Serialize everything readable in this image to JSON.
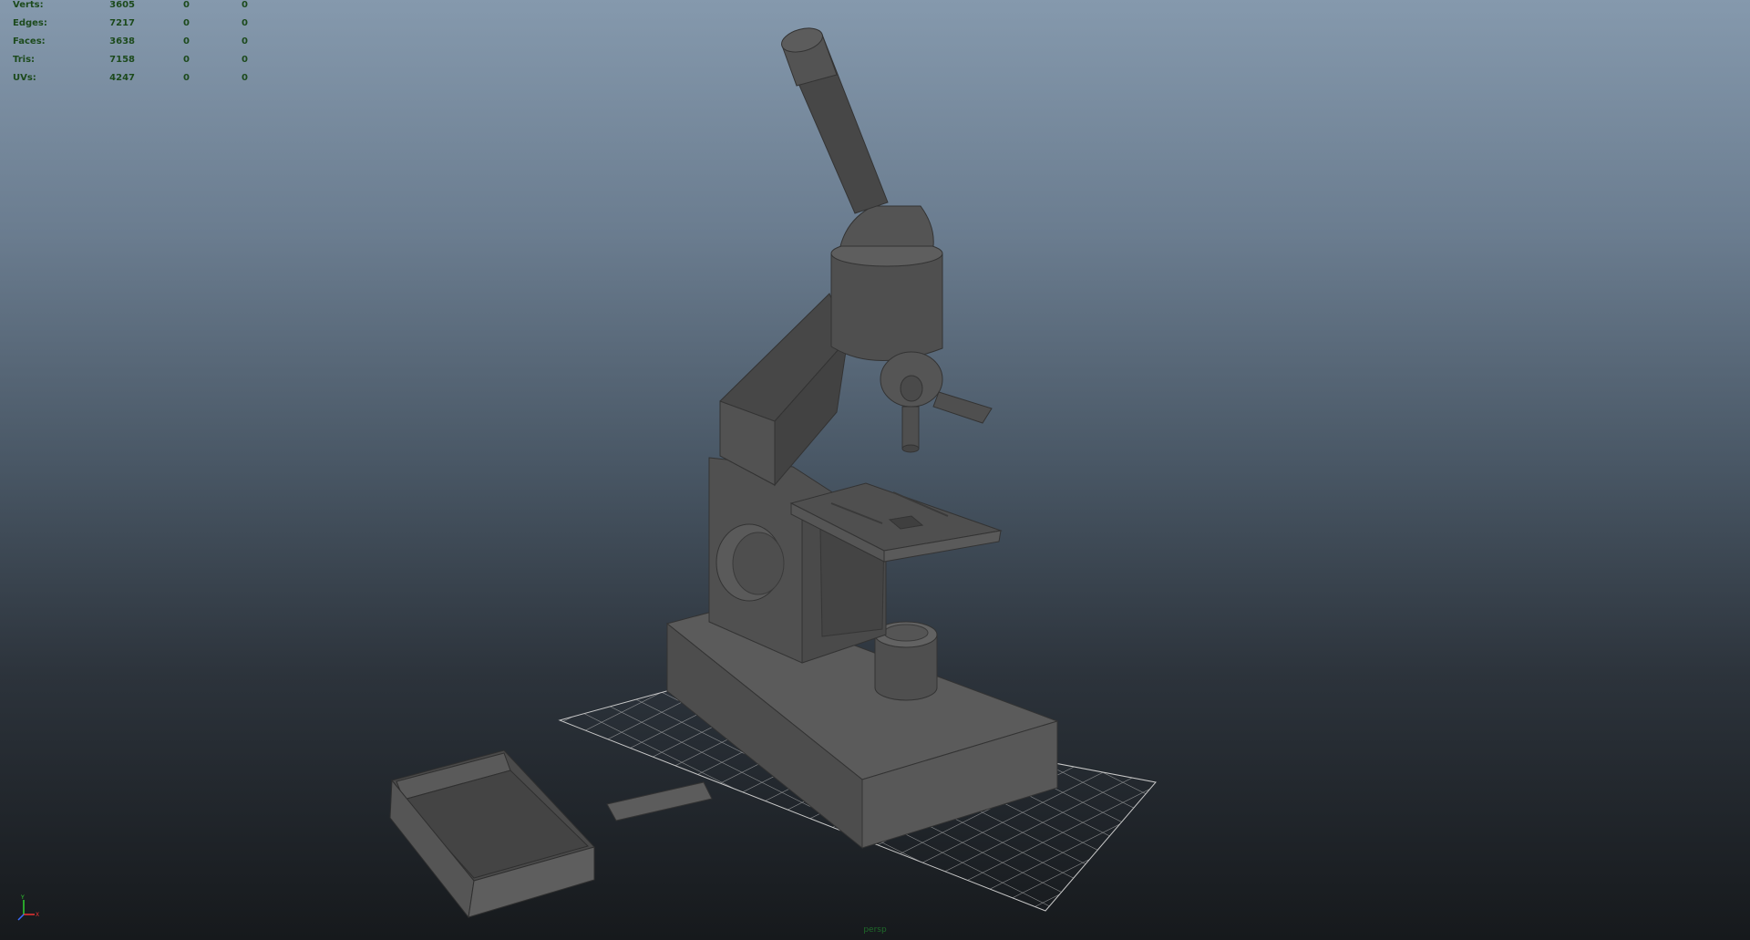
{
  "hud": {
    "rows": [
      {
        "label": "Verts:",
        "values": [
          "3605",
          "0",
          "0"
        ]
      },
      {
        "label": "Edges:",
        "values": [
          "7217",
          "0",
          "0"
        ]
      },
      {
        "label": "Faces:",
        "values": [
          "3638",
          "0",
          "0"
        ]
      },
      {
        "label": "Tris:",
        "values": [
          "7158",
          "0",
          "0"
        ]
      },
      {
        "label": "UVs:",
        "values": [
          "4247",
          "0",
          "0"
        ]
      }
    ]
  },
  "axis": {
    "y_label": "Y",
    "x_label": "X",
    "z_label": "Z"
  },
  "camera": {
    "name": "persp"
  },
  "colors": {
    "hud_text": "#1c4a1c",
    "model_gray": "#555555",
    "grid_line": "#bfbfbf",
    "camera_label": "#1f6b2a"
  }
}
